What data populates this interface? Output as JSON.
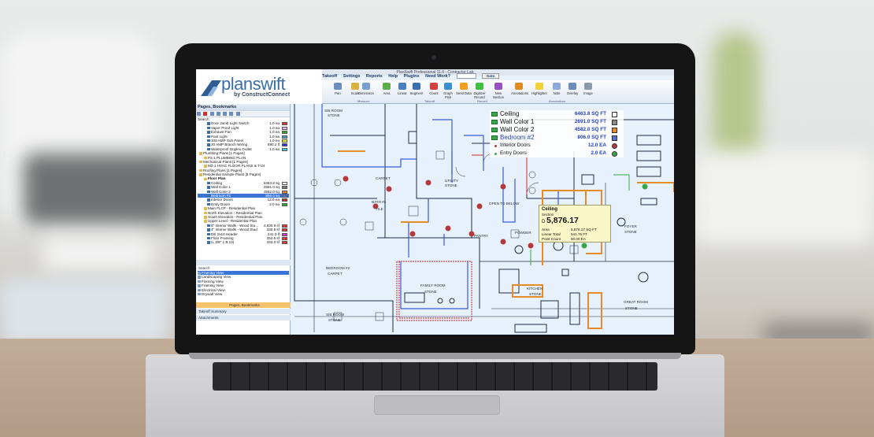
{
  "app": {
    "title": "PlanSwift Professional 11.0 - Contractor Lab",
    "logo_text": "planswift",
    "logo_sub": "by ConstructConnect"
  },
  "menu": {
    "items": [
      "Takeoff",
      "Settings",
      "Reports",
      "Help",
      "Plugins",
      "Need Work?"
    ],
    "search_placeholder": "Search",
    "search_button": "Goto"
  },
  "ribbon": {
    "buttons": [
      {
        "label": "Pan",
        "color": "#6c8ebf"
      },
      {
        "label": "Scale",
        "color": "#d9b23b"
      },
      {
        "label": "Dimension",
        "color": "#7a9ecf"
      },
      {
        "label": "Area",
        "color": "#5cae4c"
      },
      {
        "label": "Linear",
        "color": "#4a7fc0"
      },
      {
        "label": "Segment",
        "color": "#3a6fb0"
      },
      {
        "label": "Count",
        "color": "#d24040"
      },
      {
        "label": "Graph Pick",
        "color": "#3b8fd0"
      },
      {
        "label": "Send Data",
        "color": "#f0a020"
      },
      {
        "label": "Digitizer Record",
        "color": "#3fbf3f"
      },
      {
        "label": "New Section",
        "color": "#9a4fc0"
      },
      {
        "label": "Annotations",
        "color": "#e08a20"
      },
      {
        "label": "Highlighter",
        "color": "#f2d23a"
      },
      {
        "label": "Note",
        "color": "#8aa8d8"
      },
      {
        "label": "Overlay",
        "color": "#6b8bb8"
      },
      {
        "label": "Image",
        "color": "#8a9aaa"
      }
    ],
    "groups": [
      "Measure",
      "Takeoff",
      "Record",
      "Annotations"
    ]
  },
  "panel": {
    "title": "Pages, Bookmarks",
    "search_label": "Search",
    "tree": [
      {
        "label": "Door Jamb Light Switch",
        "value": "1.0 ea",
        "color": "#d33"
      },
      {
        "label": "Vapor Proof Light",
        "value": "1.0 ea",
        "color": "#e3b6e8"
      },
      {
        "label": "Exhaust Fan",
        "value": "1.0 ea",
        "color": "#3a3"
      },
      {
        "label": "Pant Light",
        "value": "1.0 ea",
        "color": "#4ab"
      },
      {
        "label": "100 AMP Sub Panel",
        "value": "1.0 ea",
        "color": "#ee3"
      },
      {
        "label": "20 AMP Branch Wiring",
        "value": "890.2 lf",
        "color": "#33d"
      },
      {
        "label": "Waterproof Duplex Outlet",
        "value": "1.0 ea",
        "color": "#4cd"
      },
      {
        "label": "Plumbing Plans [1 Pages]",
        "value": "",
        "color": ""
      },
      {
        "label": "P2-1 PLUMBING PLAN",
        "value": "",
        "color": ""
      },
      {
        "label": "Mechanical Plans [1 Pages]",
        "value": "",
        "color": ""
      },
      {
        "label": "M2-1 HVAC FLOOR PLANS & T-24",
        "value": "",
        "color": ""
      },
      {
        "label": "Roofing Plans [1 Pages]",
        "value": "",
        "color": ""
      },
      {
        "label": "Residential Sample Plans [8 Pages]",
        "value": "",
        "color": ""
      },
      {
        "label": "Floor Plan",
        "value": "",
        "color": ""
      },
      {
        "label": "Ceiling",
        "value": "6463.8 sq",
        "color": "#fff"
      },
      {
        "label": "Wall Color 1",
        "value": "2691.0 sq",
        "color": "#777"
      },
      {
        "label": "Wall Color 2",
        "value": "4582.0 sq",
        "color": "#e68a2e"
      },
      {
        "label": "Bedroom #2",
        "value": "806.0 sq",
        "color": "#5a72d6"
      },
      {
        "label": "Interior Doors",
        "value": "12.0 ea",
        "color": "#b33"
      },
      {
        "label": "Entry Doors",
        "value": "2.0 ea",
        "color": "#3a3"
      },
      {
        "label": "Main FLCP - Residential Plan",
        "value": "",
        "color": ""
      },
      {
        "label": "North Elevation - Residential Plan",
        "value": "",
        "color": ""
      },
      {
        "label": "South Elevation - Residential Plan",
        "value": "",
        "color": ""
      },
      {
        "label": "Upper Level - Residential Plan",
        "value": "",
        "color": ""
      },
      {
        "label": "6\" Interior Walls - Wood Stu...",
        "value": "4,830.9 sf",
        "color": "#e33"
      },
      {
        "label": "4\" Interior Walls - Wood Stud",
        "value": "330.5 sf",
        "color": "#e33"
      },
      {
        "label": "DE 2x10 Header",
        "value": "241.0 lf",
        "color": "#d3d"
      },
      {
        "label": "Floor Framing",
        "value": "352.6 sf",
        "color": "#e33"
      },
      {
        "label": "(L 3/8\" 1 B.10)",
        "value": "333.0 sf",
        "color": "#e33"
      }
    ],
    "views_search": "Search",
    "views": [
      "Framing View",
      "Landscaping View",
      "Flooring View",
      "Framing View",
      "Electrical View",
      "Drywall View"
    ],
    "tabs": [
      "Pages, Bookmarks",
      "Takeoff Summary",
      "Attachments"
    ]
  },
  "legend": {
    "rows": [
      {
        "name": "Ceiling",
        "value": "6463.8 SQ FT",
        "color": "#ffffff",
        "kind": "area",
        "text_color": "#111111"
      },
      {
        "name": "Wall Color 1",
        "value": "2691.0 SQ FT",
        "color": "#8a8a8a",
        "kind": "area",
        "text_color": "#111111"
      },
      {
        "name": "Wall Color 2",
        "value": "4582.0 SQ FT",
        "color": "#e68a2e",
        "kind": "area",
        "text_color": "#111111"
      },
      {
        "name": "Bedroom #2",
        "value": "806.0 SQ FT",
        "color": "#5a72d6",
        "kind": "area",
        "text_color": "#1f3fbf"
      },
      {
        "name": "Interior Doors",
        "value": "12.0 EA",
        "color": "#b33a3a",
        "kind": "count",
        "text_color": "#111111"
      },
      {
        "name": "Entry Doors",
        "value": "2.0 EA",
        "color": "#3aa64a",
        "kind": "count",
        "text_color": "#111111"
      }
    ]
  },
  "card": {
    "title": "Ceiling",
    "subtitle": "Section",
    "value": "5,876.17",
    "lines": [
      {
        "label": "Area",
        "value": "5,876.17 SQ FT"
      },
      {
        "label": "Linear Total",
        "value": "541.76 FT"
      },
      {
        "label": "Point Count",
        "value": "50.00 EA"
      }
    ]
  },
  "plan_labels": [
    "SIB ROOM",
    "STONE",
    "CARPET",
    "BATH #2",
    "TILE",
    "UTILITY",
    "STONE",
    "OPEN TO BELOW",
    "PANTRY",
    "POWDER",
    "BEDROOM #2",
    "CARPET",
    "FAMILY ROOM",
    "STONE",
    "KITCHEN",
    "STONE",
    "FOYER",
    "STONE",
    "GREAT ROOM",
    "STONE",
    "SIB ROOM",
    "STONE"
  ],
  "colors": {
    "area_outline": "#e68a2e",
    "bedroom_outline": "#3b5bdb",
    "count_marker": "#b33a3a",
    "wall_red": "#d44b4b"
  }
}
